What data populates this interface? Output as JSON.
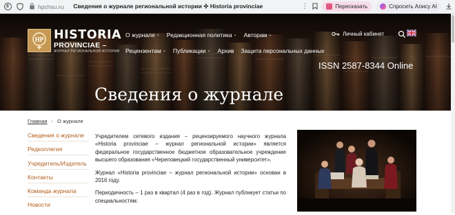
{
  "browser": {
    "url": "hpchsu.ru",
    "tab_title": "Сведения о журнале региональной истории ✣ Historia provinciae",
    "translate_label": "Пересказать",
    "alisa_label": "Спросить Алису AI"
  },
  "header": {
    "logo_badge": "HP",
    "logo_title": "HISTORIA",
    "logo_sub1": "PROVINCIAE –",
    "logo_sub2": "ЖУРНАЛ РЕГИОНАЛЬНОЙ ИСТОРИИ",
    "nav_row1": [
      "О журнале",
      "Редакционная политика",
      "Авторам"
    ],
    "nav_row2": [
      "Рецензентам",
      "Публикации",
      "Архив",
      "Защита персональных данных"
    ],
    "cabinet_label": "Личный кабинет",
    "issn": "ISSN 2587-8344 Online",
    "page_title": "Сведения о журнале"
  },
  "breadcrumb": {
    "home": "Главная",
    "current": "О журнале"
  },
  "sidebar": {
    "items": [
      "Сведения о журнале",
      "Редколлегия",
      "Учредитель/Издатель",
      "Контакты",
      "Команда журнала",
      "Новости"
    ]
  },
  "main": {
    "paragraphs": [
      "Учредителем сетевого издания – рецензируемого научного журнала «Historia provinciae – журнал региональной истории» является федеральное государственное бюджетное образовательное учреждение высшего образования «Череповецкий государственный университет».",
      "Журнал «Historia provinciae – журнал региональной истории» основан в 2016 году.",
      "Периодичность – 1 раз в квартал (4 раз в год). Журнал публикует статьи по специальностям:"
    ]
  },
  "colors": {
    "accent": "#b05c1a",
    "hero_bg": "#2a1a12",
    "logo_gold": "#c69854"
  }
}
